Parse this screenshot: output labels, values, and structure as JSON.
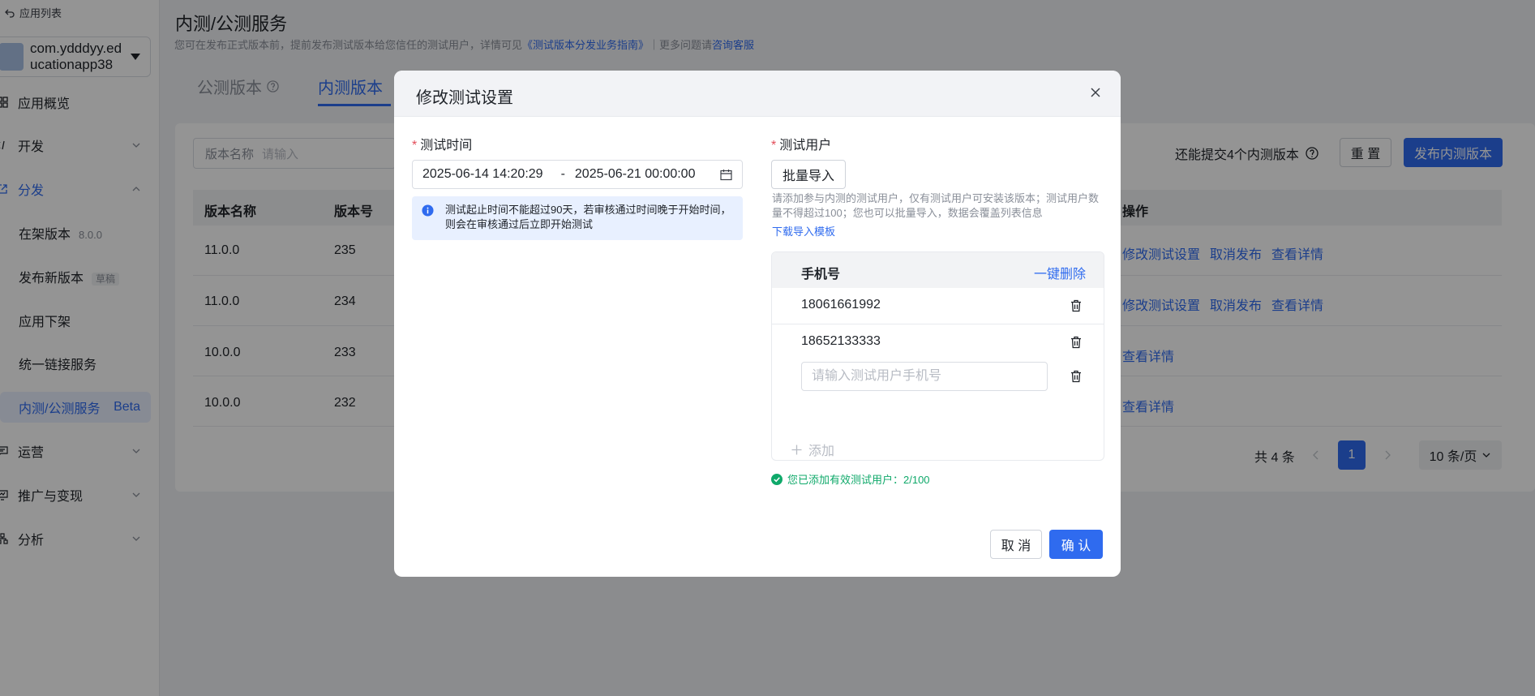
{
  "sidebar": {
    "back_label": "应用列表",
    "app_name": "com.ydddyy.educationapp38",
    "items": [
      {
        "label": "应用概览"
      },
      {
        "label": "开发"
      },
      {
        "label": "分发"
      },
      {
        "label": "运营"
      },
      {
        "label": "推广与变现"
      },
      {
        "label": "分析"
      }
    ],
    "sub_items": [
      {
        "label": "在架版本",
        "tag": "8.0.0"
      },
      {
        "label": "发布新版本",
        "tag": "草稿"
      },
      {
        "label": "应用下架"
      },
      {
        "label": "统一链接服务"
      },
      {
        "label": "内测/公测服务",
        "tag": "Beta"
      }
    ]
  },
  "header": {
    "title": "内测/公测服务",
    "desc_prefix": "您可在发布正式版本前，提前发布测试版本给您信任的测试用户，详情可见",
    "desc_link": "《测试版本分发业务指南》",
    "desc_mid": "｜更多问题请",
    "desc_link2": "咨询客服"
  },
  "tabs": [
    {
      "label": "公测版本"
    },
    {
      "label": "内测版本"
    }
  ],
  "toolbar": {
    "search_label": "版本名称",
    "search_placeholder": "请输入",
    "quota": "还能提交4个内测版本",
    "reset": "重 置",
    "publish": "发布内测版本"
  },
  "table": {
    "columns": [
      "版本名称",
      "版本号",
      "操作"
    ],
    "rows": [
      {
        "name": "11.0.0",
        "code": "235",
        "ops": [
          "修改测试设置",
          "取消发布",
          "查看详情"
        ]
      },
      {
        "name": "11.0.0",
        "code": "234",
        "ops": [
          "修改测试设置",
          "取消发布",
          "查看详情"
        ]
      },
      {
        "name": "10.0.0",
        "code": "233",
        "ops": [
          "查看详情"
        ]
      },
      {
        "name": "10.0.0",
        "code": "232",
        "ops": [
          "查看详情"
        ]
      }
    ]
  },
  "pagination": {
    "total": "共 4 条",
    "page": "1",
    "size": "10 条/页"
  },
  "modal": {
    "title": "修改测试设置",
    "time_label": "测试时间",
    "start": "2025-06-14 14:20:29",
    "separator": "-",
    "end": "2025-06-21 00:00:00",
    "time_hint": "测试起止时间不能超过90天，若审核通过时间晚于开始时间，则会在审核通过后立即开始测试",
    "users_label": "测试用户",
    "import_button": "批量导入",
    "users_hint": "请添加参与内测的测试用户，仅有测试用户可安装该版本；测试用户数量不得超过100；您也可以批量导入，数据会覆盖列表信息",
    "download_template": "下载导入模板",
    "phone_header": "手机号",
    "delete_all": "一键删除",
    "phones": [
      "18061661992",
      "18652133333"
    ],
    "phone_placeholder": "请输入测试用户手机号",
    "add_label": "添加",
    "status": "您已添加有效测试用户：2/100",
    "cancel": "取 消",
    "confirm": "确 认"
  },
  "colors": {
    "accent": "#2f6bef",
    "success": "#0fa96a",
    "required": "#e34d59"
  }
}
